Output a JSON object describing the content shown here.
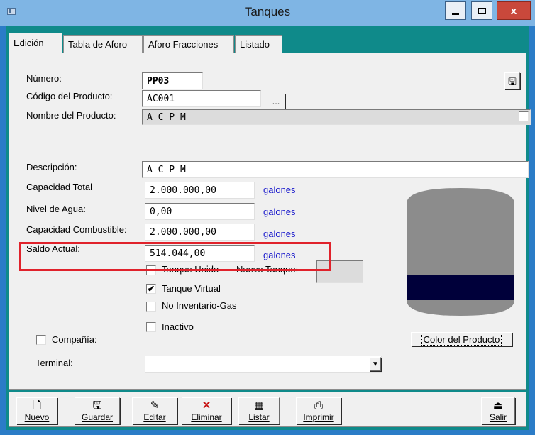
{
  "window": {
    "title": "Tanques"
  },
  "tabs": [
    {
      "label": "Edición"
    },
    {
      "label": "Tabla de Aforo"
    },
    {
      "label": "Aforo Fracciones"
    },
    {
      "label": "Listado"
    }
  ],
  "form": {
    "numero_label": "Número:",
    "numero_value": "PP03",
    "codigo_label": "Código del Producto:",
    "codigo_value": "AC001",
    "browse_label": "...",
    "nombre_label": "Nombre del Producto:",
    "nombre_value": "A C P M",
    "descripcion_label": "Descripción:",
    "descripcion_value": "A C P M",
    "capacidad_total_label": "Capacidad Total",
    "capacidad_total_value": "2.000.000,00",
    "nivel_agua_label": "Nivel de Agua:",
    "nivel_agua_value": "0,00",
    "capacidad_comb_label": "Capacidad Combustible:",
    "capacidad_comb_value": "2.000.000,00",
    "saldo_label": "Saldo Actual:",
    "saldo_value": "514.044,00",
    "unit": "galones",
    "tanque_unido_label": "Tanque Unido",
    "nuevo_tanque_label": "Nuevo Tanque:",
    "tanque_virtual_label": "Tanque Virtual",
    "no_inventario_label": "No Inventario-Gas",
    "inactivo_label": "Inactivo",
    "compania_label": "Compañía:",
    "terminal_label": "Terminal:",
    "terminal_value": "",
    "color_button_label": "Color del Producto"
  },
  "checks": {
    "tanque_unido": false,
    "tanque_virtual": true,
    "no_inventario": false,
    "inactivo": false,
    "compania": false
  },
  "tank": {
    "fill_level": 0.2,
    "fill_color": "#00003a",
    "body_color": "#8c8c8c"
  },
  "toolbar": {
    "nuevo": "Nuevo",
    "guardar": "Guardar",
    "editar": "Editar",
    "eliminar": "Eliminar",
    "listar": "Listar",
    "imprimir": "Imprimir",
    "salir": "Salir"
  },
  "colors": {
    "highlight": "#e0222b",
    "unit_text": "#1a1acc",
    "client_bg": "#0f8a8a"
  }
}
